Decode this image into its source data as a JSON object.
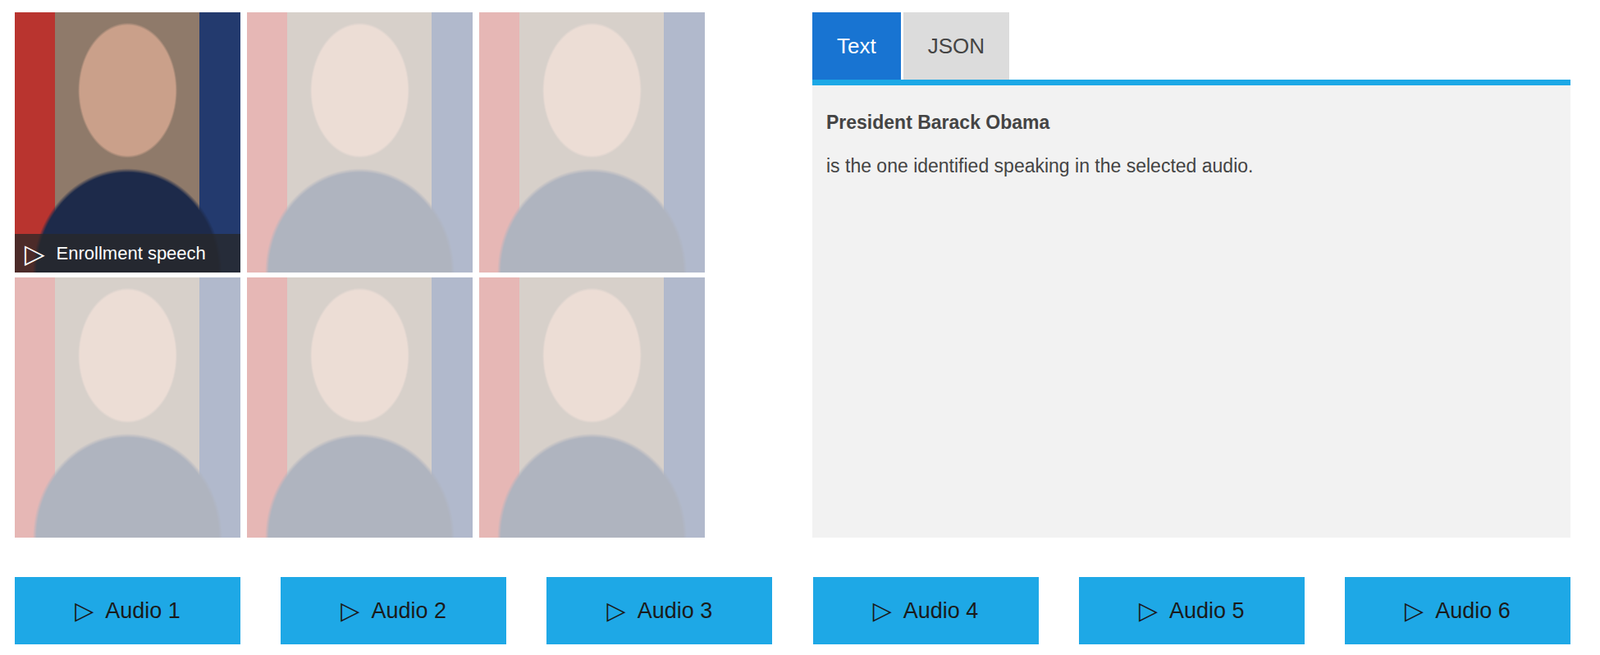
{
  "speakers": [
    {
      "selected": true,
      "caption": {
        "icon": "▷",
        "label": "Enrollment speech"
      }
    },
    {
      "selected": false
    },
    {
      "selected": false
    },
    {
      "selected": false
    },
    {
      "selected": false
    },
    {
      "selected": false
    }
  ],
  "tabs": [
    {
      "label": "Text",
      "selected": true
    },
    {
      "label": "JSON",
      "selected": false
    }
  ],
  "result": {
    "speaker": "President Barack Obama",
    "message": "is the one identified speaking in the selected audio."
  },
  "audio_buttons": [
    {
      "icon": "▷",
      "label": "Audio 1"
    },
    {
      "icon": "▷",
      "label": "Audio 2"
    },
    {
      "icon": "▷",
      "label": "Audio 3"
    },
    {
      "icon": "▷",
      "label": "Audio 4"
    },
    {
      "icon": "▷",
      "label": "Audio 5"
    },
    {
      "icon": "▷",
      "label": "Audio 6"
    }
  ]
}
